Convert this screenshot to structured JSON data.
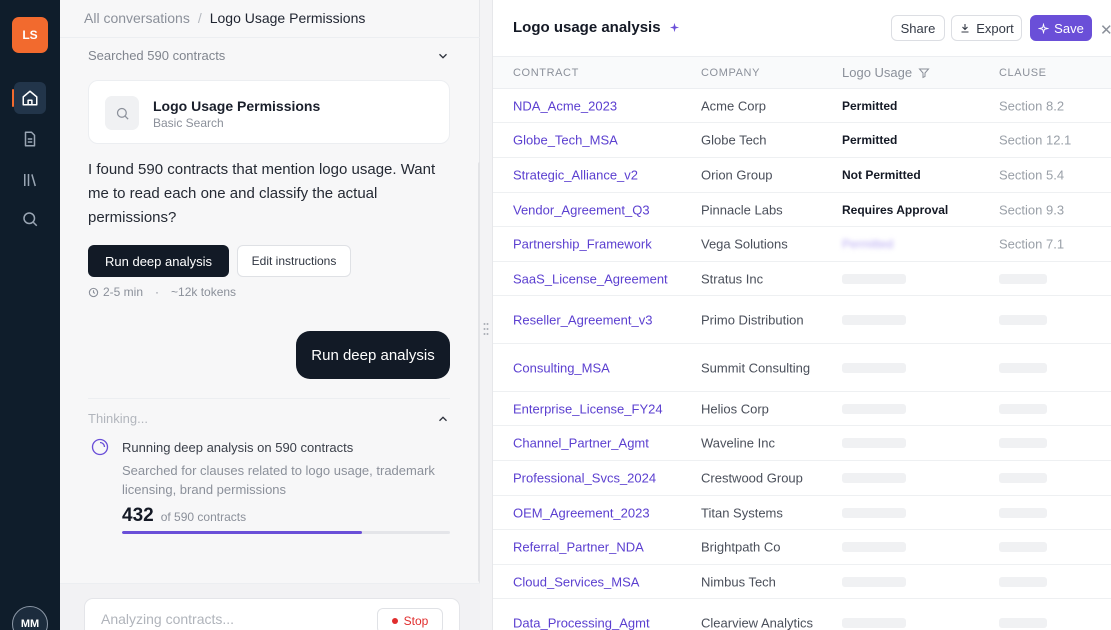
{
  "rail": {
    "logo": "LS",
    "avatar": "MM",
    "items": [
      {
        "name": "home",
        "active": true
      },
      {
        "name": "document",
        "active": false
      },
      {
        "name": "library",
        "active": false
      },
      {
        "name": "search",
        "active": false
      }
    ]
  },
  "chat": {
    "breadcrumb_root": "All conversations",
    "breadcrumb_sep": "/",
    "breadcrumb_current": "Logo Usage Permissions",
    "searched_label": "Searched 590 contracts",
    "search_card": {
      "title": "Logo Usage Permissions",
      "subtitle": "Basic Search"
    },
    "message": "I found 590 contracts that mention logo usage. Want me to read each one and classify the actual permissions?",
    "primary_action": "Run deep analysis",
    "secondary_action": "Edit instructions",
    "estimate_time": "2-5 min",
    "estimate_dot": "·",
    "estimate_tokens": "~12k tokens",
    "user_message": "Run deep analysis",
    "thinking_label": "Thinking...",
    "run_title": "Running deep analysis on 590 contracts",
    "run_desc": "Searched for clauses related to logo usage, trademark licensing, brand permissions",
    "progress_count": "432",
    "progress_total": "of 590 contracts",
    "progress_fraction": 0.732,
    "composer_placeholder": "Analyzing contracts...",
    "stop_label": "Stop"
  },
  "panel": {
    "title": "Logo usage analysis",
    "share": "Share",
    "export": "Export",
    "save": "Save",
    "columns": {
      "contract": "Contract",
      "company": "Company",
      "usage": "Logo Usage",
      "clause": "Clause"
    },
    "rows": [
      {
        "contract": "NDA_Acme_2023",
        "company": "Acme Corp",
        "usage": "Permitted",
        "clause": "Section 8.2",
        "state": "done"
      },
      {
        "contract": "Globe_Tech_MSA",
        "company": "Globe Tech",
        "usage": "Permitted",
        "clause": "Section 12.1",
        "state": "done"
      },
      {
        "contract": "Strategic_Alliance_v2",
        "company": "Orion Group",
        "usage": "Not Permitted",
        "clause": "Section 5.4",
        "state": "done"
      },
      {
        "contract": "Vendor_Agreement_Q3",
        "company": "Pinnacle Labs",
        "usage": "Requires Approval",
        "clause": "Section 9.3",
        "state": "done"
      },
      {
        "contract": "Partnership_Framework",
        "company": "Vega Solutions",
        "usage": "Permitted",
        "clause": "Section 7.1",
        "state": "blur"
      },
      {
        "contract": "SaaS_License_Agreement",
        "company": "Stratus Inc",
        "usage": "",
        "clause": "",
        "state": "pending"
      },
      {
        "contract": "Reseller_Agreement_v3",
        "company": "Primo Distribution",
        "usage": "",
        "clause": "",
        "state": "pending"
      },
      {
        "contract": "Consulting_MSA",
        "company": "Summit Consulting",
        "usage": "",
        "clause": "",
        "state": "pending"
      },
      {
        "contract": "Enterprise_License_FY24",
        "company": "Helios Corp",
        "usage": "",
        "clause": "",
        "state": "pending"
      },
      {
        "contract": "Channel_Partner_Agmt",
        "company": "Waveline Inc",
        "usage": "",
        "clause": "",
        "state": "pending"
      },
      {
        "contract": "Professional_Svcs_2024",
        "company": "Crestwood Group",
        "usage": "",
        "clause": "",
        "state": "pending"
      },
      {
        "contract": "OEM_Agreement_2023",
        "company": "Titan Systems",
        "usage": "",
        "clause": "",
        "state": "pending"
      },
      {
        "contract": "Referral_Partner_NDA",
        "company": "Brightpath Co",
        "usage": "",
        "clause": "",
        "state": "pending"
      },
      {
        "contract": "Cloud_Services_MSA",
        "company": "Nimbus Tech",
        "usage": "",
        "clause": "",
        "state": "pending"
      },
      {
        "contract": "Data_Processing_Agmt",
        "company": "Clearview Analytics",
        "usage": "",
        "clause": "",
        "state": "pending"
      }
    ]
  },
  "colors": {
    "accent": "#6a4fd8",
    "rail_bg": "#0f1d2b",
    "logo_bg": "#f26a2e",
    "stop": "#e02d2d"
  }
}
